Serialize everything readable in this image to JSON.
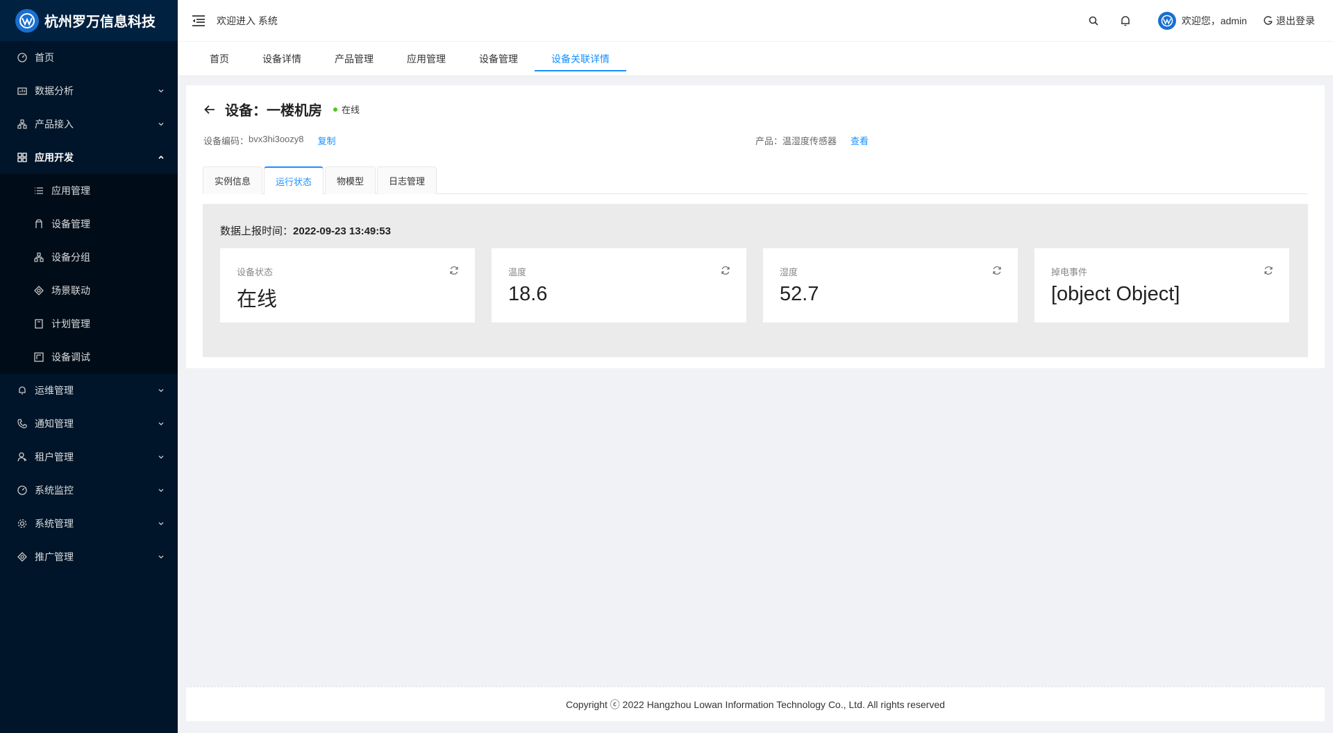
{
  "brand": {
    "name": "杭州罗万信息科技"
  },
  "sidebar": {
    "items": [
      {
        "label": "首页",
        "icon": "dashboard-icon"
      },
      {
        "label": "数据分析",
        "icon": "chart-icon"
      },
      {
        "label": "产品接入",
        "icon": "cluster-icon"
      },
      {
        "label": "应用开发",
        "icon": "appstore-icon",
        "open": true
      }
    ],
    "subitems": [
      {
        "label": "应用管理"
      },
      {
        "label": "设备管理"
      },
      {
        "label": "设备分组"
      },
      {
        "label": "场景联动"
      },
      {
        "label": "计划管理"
      },
      {
        "label": "设备调试"
      }
    ],
    "items_after": [
      {
        "label": "运维管理"
      },
      {
        "label": "通知管理"
      },
      {
        "label": "租户管理"
      },
      {
        "label": "系统监控"
      },
      {
        "label": "系统管理"
      },
      {
        "label": "推广管理"
      }
    ]
  },
  "header": {
    "welcome": "欢迎进入 系统",
    "user_greeting": "欢迎您，admin",
    "logout": "退出登录"
  },
  "nav_tabs": [
    "首页",
    "设备详情",
    "产品管理",
    "应用管理",
    "设备管理",
    "设备关联详情"
  ],
  "device": {
    "title": "设备：一楼机房",
    "status": "在线",
    "code_label": "设备编码：",
    "code": "bvx3hi3oozy8",
    "copy": "复制",
    "product_label": "产品：",
    "product": "温湿度传感器",
    "view": "查看"
  },
  "inner_tabs": [
    "实例信息",
    "运行状态",
    "物模型",
    "日志管理"
  ],
  "run_state": {
    "report_label": "数据上报时间：",
    "report_time": "2022-09-23 13:49:53",
    "metrics": [
      {
        "label": "设备状态",
        "value": "在线"
      },
      {
        "label": "温度",
        "value": "18.6"
      },
      {
        "label": "湿度",
        "value": "52.7"
      },
      {
        "label": "掉电事件",
        "value": "[object Object]"
      }
    ]
  },
  "footer": {
    "copyright": "Copyright ⓒ 2022 Hangzhou Lowan Information Technology Co., Ltd. All rights reserved"
  },
  "colors": {
    "sidebar_bg": "#001529",
    "accent": "#1890ff",
    "online": "#52c41a"
  }
}
